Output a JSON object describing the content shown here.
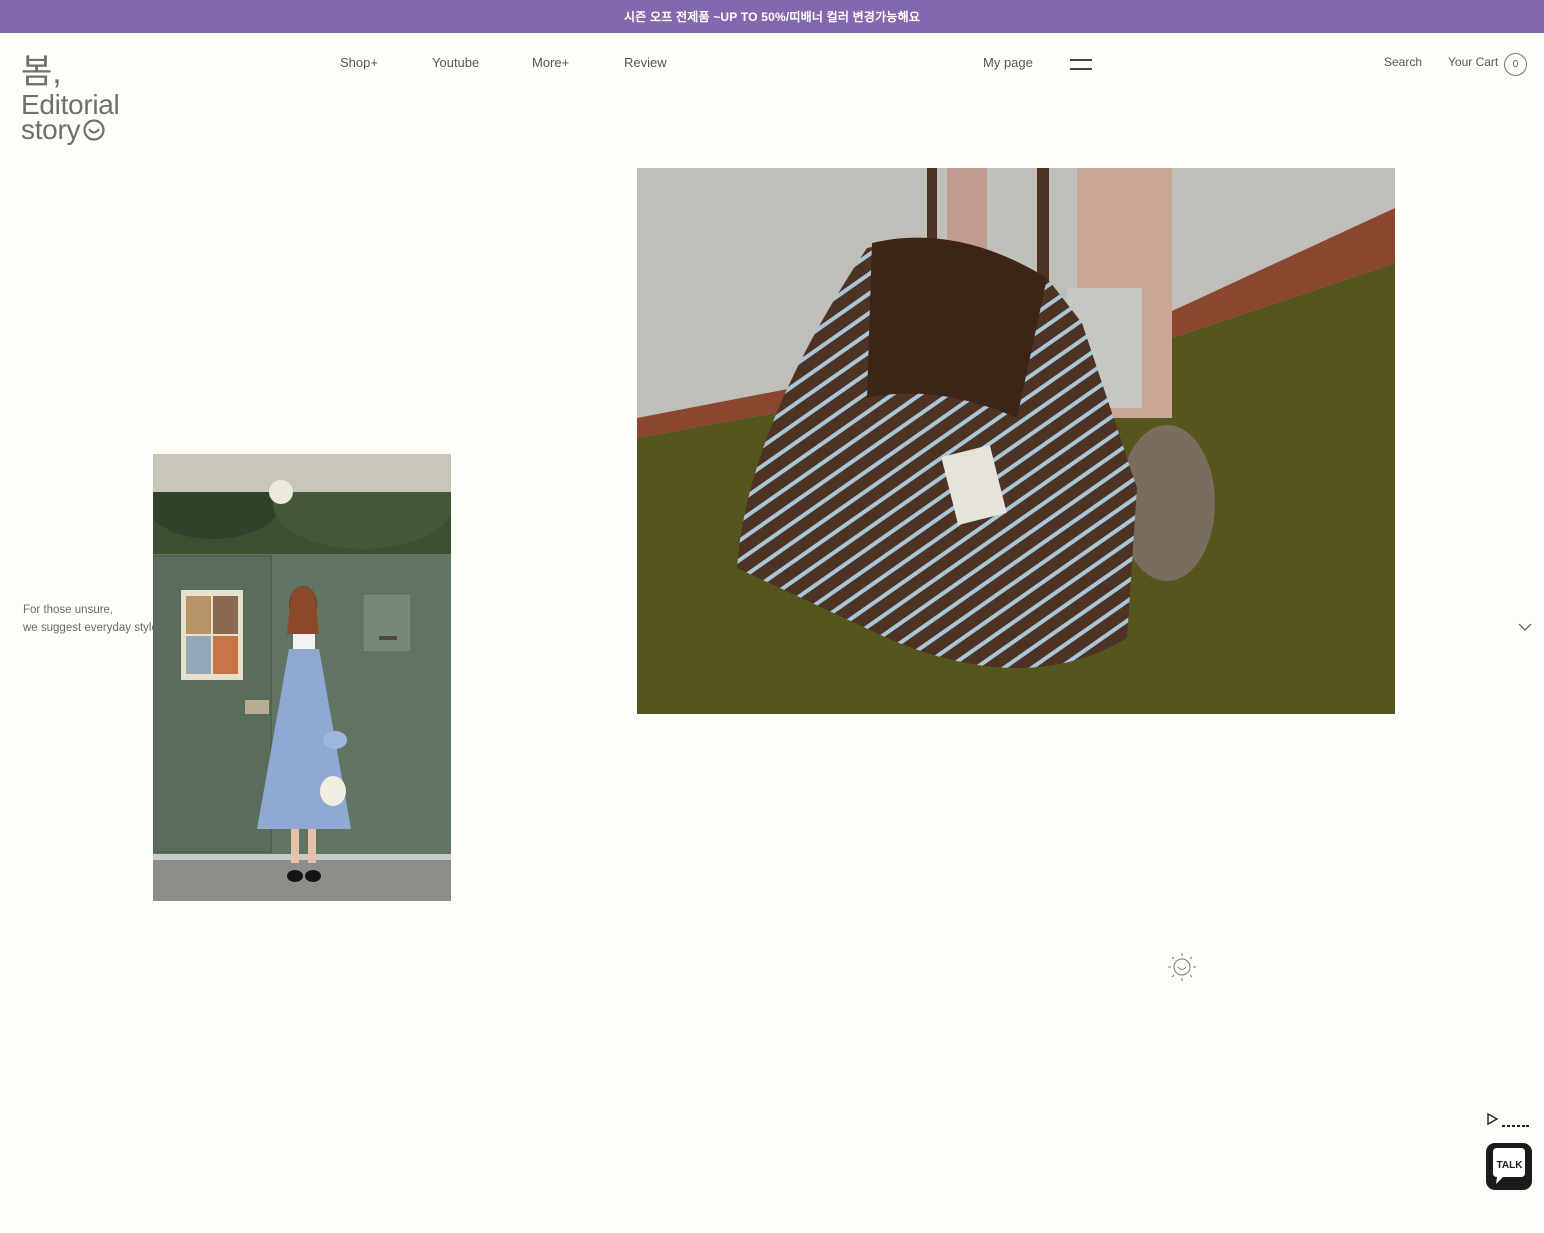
{
  "promo_banner": {
    "text": "시즌 오프 전제품 ~UP TO 50%/띠배너 컬러 변경가능해요"
  },
  "logo": {
    "line1": "봄,",
    "line2": "Editorial",
    "line3": "story"
  },
  "nav": {
    "items": [
      {
        "label": "Shop+"
      },
      {
        "label": "Youtube"
      },
      {
        "label": "More+"
      },
      {
        "label": "Review"
      }
    ],
    "my_page": "My page"
  },
  "utility": {
    "search": "Search",
    "cart_label": "Your Cart",
    "cart_count": "0"
  },
  "hero": {
    "caption_line1": "For those unsure,",
    "caption_line2": "we suggest everyday style"
  },
  "chat": {
    "talk_label": "TALK"
  },
  "colors": {
    "promo": "#8468ad",
    "background": "#fefdf8",
    "talk_bg": "#1c1b1b"
  }
}
